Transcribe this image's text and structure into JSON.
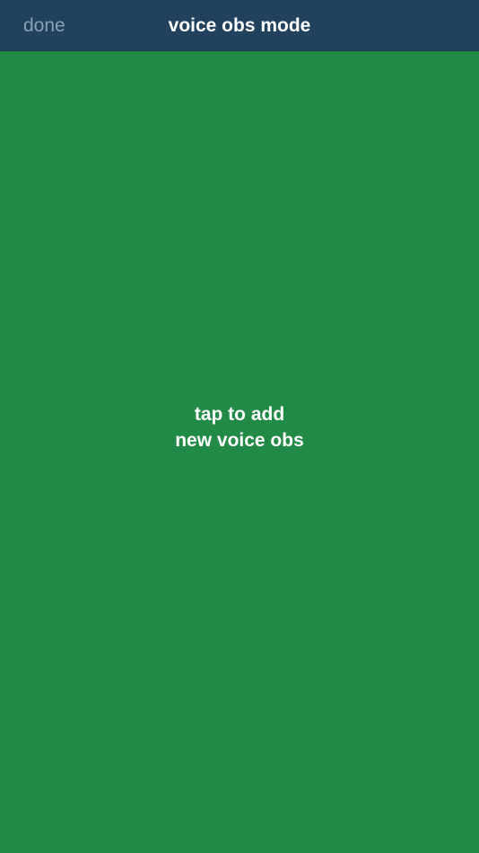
{
  "navbar": {
    "done_label": "done",
    "title": "voice obs mode"
  },
  "main": {
    "prompt_line_1": "tap to add",
    "prompt_line_2": "new voice obs"
  },
  "colors": {
    "navbar_bg": "#22415c",
    "main_bg": "#228a47",
    "done_text": "#8aa0b4",
    "title_text": "#ffffff"
  }
}
